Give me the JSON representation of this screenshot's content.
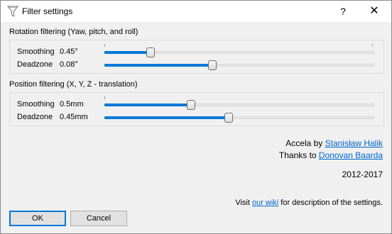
{
  "window": {
    "title": "Filter settings",
    "help_glyph": "?",
    "close_glyph": "✕"
  },
  "rotation": {
    "title": "Rotation filtering (Yaw, pitch, and roll)",
    "smoothing": {
      "label": "Smoothing",
      "value": "0.45°",
      "fraction": 0.17
    },
    "deadzone": {
      "label": "Deadzone",
      "value": "0.08°",
      "fraction": 0.4
    }
  },
  "translation": {
    "title": "Position filtering (X, Y, Z - translation)",
    "smoothing": {
      "label": "Smoothing",
      "value": "0.5mm",
      "fraction": 0.32
    },
    "deadzone": {
      "label": "Deadzone",
      "value": "0.45mm",
      "fraction": 0.46
    }
  },
  "credits": {
    "line1_prefix": "Accela by ",
    "line1_link": "Stanisław Halik",
    "line2_prefix": "Thanks to ",
    "line2_link": "Donovan Baarda",
    "years": "2012-2017"
  },
  "footnote": {
    "prefix": "Visit ",
    "link": "our wiki",
    "suffix": " for description of the settings."
  },
  "buttons": {
    "ok": "OK",
    "cancel": "Cancel"
  },
  "colors": {
    "accent": "#0078d7",
    "link": "#0066cc"
  },
  "icons": {
    "title": "funnel-icon"
  }
}
